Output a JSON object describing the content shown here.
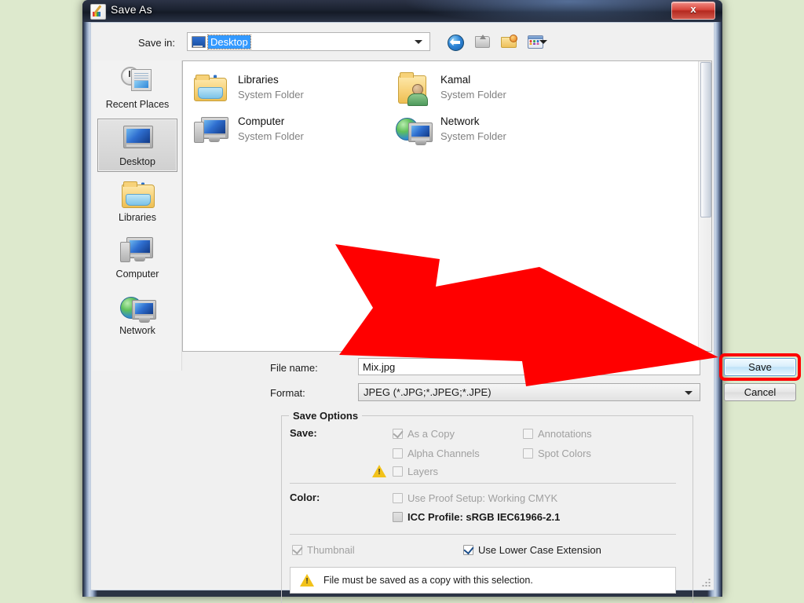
{
  "window": {
    "title": "Save As",
    "title_icon": "paint-palette-icon",
    "close_label": "x"
  },
  "savein": {
    "label": "Save in:",
    "value": "Desktop",
    "icon": "desktop-icon"
  },
  "toolbar": {
    "buttons": [
      {
        "name": "back-icon",
        "tip": "Back"
      },
      {
        "name": "up-folder-icon",
        "tip": "Up One Level"
      },
      {
        "name": "new-folder-icon",
        "tip": "Create New Folder"
      },
      {
        "name": "views-icon",
        "tip": "Views"
      }
    ]
  },
  "sidebar": {
    "items": [
      {
        "label": "Recent Places",
        "icon": "recent-places-icon",
        "selected": false
      },
      {
        "label": "Desktop",
        "icon": "desktop-icon",
        "selected": true
      },
      {
        "label": "Libraries",
        "icon": "libraries-icon",
        "selected": false
      },
      {
        "label": "Computer",
        "icon": "computer-icon",
        "selected": false
      },
      {
        "label": "Network",
        "icon": "network-icon",
        "selected": false
      }
    ]
  },
  "filelist": {
    "items": [
      {
        "name": "Libraries",
        "subtitle": "System Folder",
        "icon": "libraries-icon"
      },
      {
        "name": "Kamal",
        "subtitle": "System Folder",
        "icon": "user-folder-icon"
      },
      {
        "name": "Computer",
        "subtitle": "System Folder",
        "icon": "computer-icon"
      },
      {
        "name": "Network",
        "subtitle": "System Folder",
        "icon": "network-icon"
      }
    ]
  },
  "filename": {
    "label": "File name:",
    "value": "Mix.jpg"
  },
  "format": {
    "label": "Format:",
    "value": "JPEG (*.JPG;*.JPEG;*.JPE)"
  },
  "buttons": {
    "save": "Save",
    "cancel": "Cancel",
    "save_highlighted": true,
    "highlight_color": "#ff0000"
  },
  "save_options": {
    "legend": "Save Options",
    "save_label": "Save:",
    "color_label": "Color:",
    "checkboxes": {
      "as_a_copy": {
        "label": "As a Copy",
        "checked": true,
        "disabled": true
      },
      "annotations": {
        "label": "Annotations",
        "checked": false,
        "disabled": true
      },
      "alpha_channels": {
        "label": "Alpha Channels",
        "checked": false,
        "disabled": true
      },
      "spot_colors": {
        "label": "Spot Colors",
        "checked": false,
        "disabled": true
      },
      "layers": {
        "label": "Layers",
        "checked": false,
        "disabled": true,
        "warning": true
      },
      "use_proof_setup": {
        "label": "Use Proof Setup:  Working CMYK",
        "checked": false,
        "disabled": true
      },
      "icc_profile": {
        "label": "ICC Profile:  sRGB IEC61966-2.1",
        "checked": false,
        "disabled": false
      },
      "thumbnail": {
        "label": "Thumbnail",
        "checked": true,
        "disabled": true
      },
      "use_lower_case_extension": {
        "label": "Use Lower Case Extension",
        "checked": true,
        "disabled": false
      }
    },
    "warning": {
      "icon": "warning-triangle-icon",
      "text": "File must be saved as a copy with this selection."
    }
  },
  "annotation": {
    "arrow": "red-pointer-arrow",
    "color": "#ff0000",
    "points_to": "Save"
  },
  "background_color": "#dde9cd"
}
